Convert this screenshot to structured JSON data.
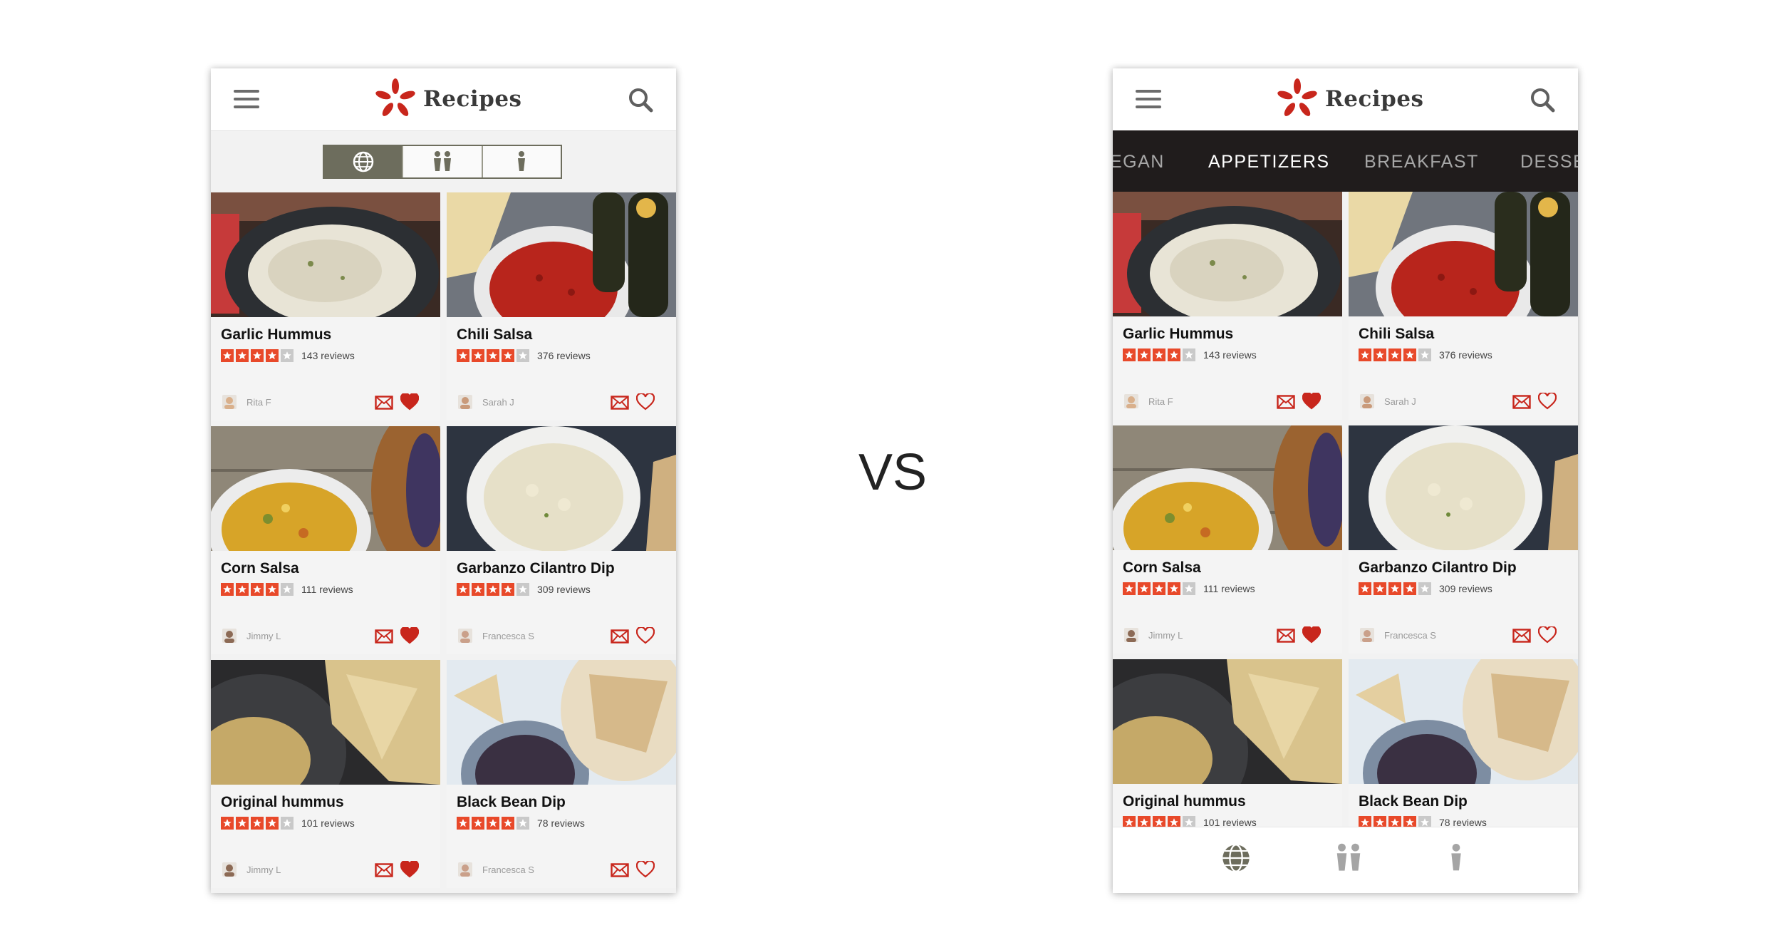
{
  "app": {
    "title": "Recipes"
  },
  "comparison": {
    "vs_label": "VS"
  },
  "colors": {
    "accent_red": "#c8261c",
    "star_orange": "#e8492a",
    "nav_dark": "#201c1c",
    "olive": "#6d6d5d"
  },
  "segmented": {
    "items": [
      {
        "icon": "globe-icon",
        "active": true
      },
      {
        "icon": "two-people-icon",
        "active": false
      },
      {
        "icon": "person-icon",
        "active": false
      }
    ]
  },
  "categories": {
    "items": [
      "EGAN",
      "APPETIZERS",
      "BREAKFAST",
      "DESSER"
    ],
    "selected": "APPETIZERS"
  },
  "bottom_nav": {
    "items": [
      "globe-icon",
      "two-people-icon",
      "person-icon"
    ],
    "selected": "globe-icon"
  },
  "recipes": [
    {
      "title": "Garlic Hummus",
      "stars": 4,
      "reviews": "143 reviews",
      "author": "Rita F",
      "favorite": true
    },
    {
      "title": "Chili Salsa",
      "stars": 4,
      "reviews": "376 reviews",
      "author": "Sarah J",
      "favorite": false
    },
    {
      "title": "Corn Salsa",
      "stars": 4,
      "reviews": "111 reviews",
      "author": "Jimmy L",
      "favorite": true
    },
    {
      "title": "Garbanzo Cilantro Dip",
      "stars": 4,
      "reviews": "309 reviews",
      "author": "Francesca S",
      "favorite": false
    },
    {
      "title": "Original hummus",
      "stars": 4,
      "reviews": "101 reviews",
      "author": "Jimmy L",
      "favorite": true
    },
    {
      "title": "Black Bean Dip",
      "stars": 4,
      "reviews": "78 reviews",
      "author": "Francesca S",
      "favorite": false
    }
  ]
}
